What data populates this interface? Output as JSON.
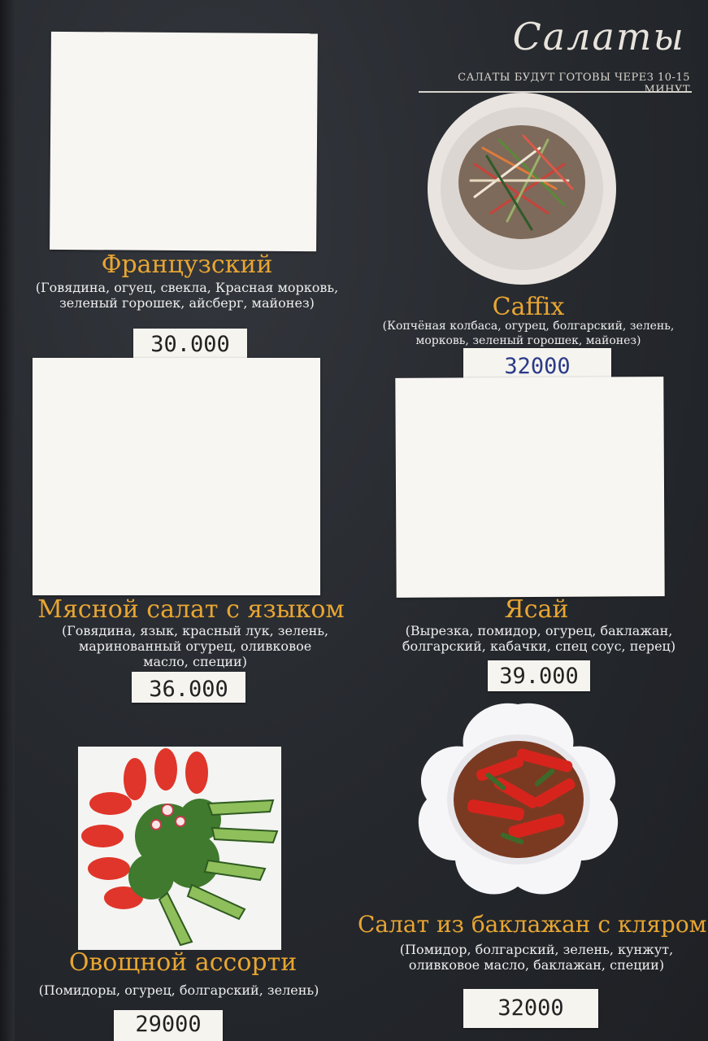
{
  "header": {
    "title": "Салаты",
    "subtitle": "САЛАТЫ БУДУТ ГОТОВЫ ЧЕРЕЗ 10-15 МИНУТ"
  },
  "items": [
    {
      "name": "Французский",
      "description": "(Говядина, огуец, свекла, Красная морковь, зеленый горошек, айсберг, майонез)",
      "price": "30.000"
    },
    {
      "name": "Caffix",
      "description": "(Копчёная колбаса, огурец, болгарский, зелень, морковь, зеленый горошек, майонез)",
      "price": "32000"
    },
    {
      "name": "Мясной салат с языком",
      "description": "(Говядина, язык, красный лук, зелень, маринованный огурец, оливковое масло, специи)",
      "price": "36.000"
    },
    {
      "name": "Ясай",
      "description": "(Вырезка, помидор, огурец, баклажан, болгарский, кабачки, спец соус, перец)",
      "price": "39.000"
    },
    {
      "name": "Овощной ассорти",
      "description": "(Помидоры, огурец, болгарский, зелень)",
      "price": "29000"
    },
    {
      "name": "Салат из баклажан с кляром",
      "description": "(Помидор, болгарский, зелень, кунжут, оливковое масло, баклажан, специи)",
      "price": "32000"
    }
  ],
  "colors": {
    "background": "#25282d",
    "name_gold": "#e8a632",
    "text_light": "#eeeeee",
    "price_card": "#f5f4ef"
  }
}
